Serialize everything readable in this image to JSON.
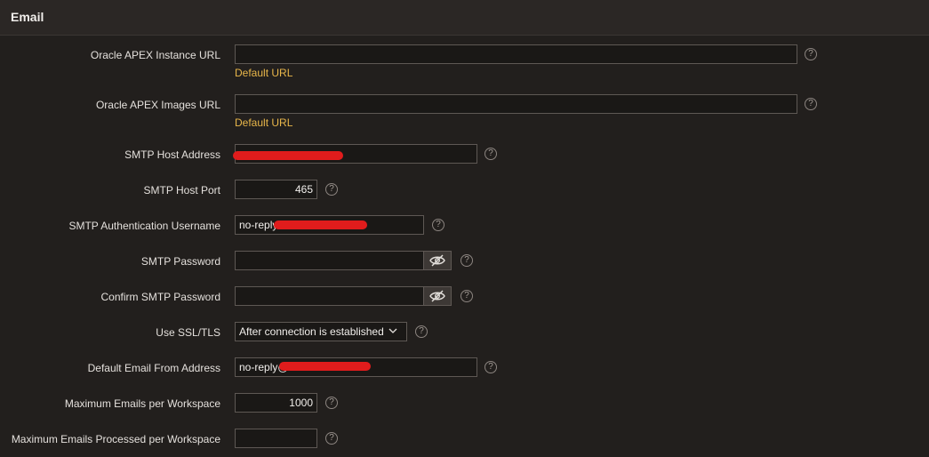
{
  "header": {
    "title": "Email"
  },
  "fields": {
    "instance_url": {
      "label": "Oracle APEX Instance URL",
      "value": "",
      "link": "Default URL"
    },
    "images_url": {
      "label": "Oracle APEX Images URL",
      "value": "",
      "link": "Default URL"
    },
    "smtp_host": {
      "label": "SMTP Host Address",
      "value": ""
    },
    "smtp_port": {
      "label": "SMTP Host Port",
      "value": "465"
    },
    "smtp_user": {
      "label": "SMTP Authentication Username",
      "value": "no-reply"
    },
    "smtp_password": {
      "label": "SMTP Password",
      "value": ""
    },
    "confirm_password": {
      "label": "Confirm SMTP Password",
      "value": ""
    },
    "ssl": {
      "label": "Use SSL/TLS",
      "value": "After connection is established"
    },
    "from_address": {
      "label": "Default Email From Address",
      "value": "no-reply@"
    },
    "max_emails": {
      "label": "Maximum Emails per Workspace",
      "value": "1000"
    },
    "max_processed": {
      "label": "Maximum Emails Processed per Workspace",
      "value": ""
    }
  },
  "help_glyph": "?",
  "icons": {
    "help": "help-circle-icon",
    "eye": "eye-slash-icon",
    "chevron": "chevron-down-icon"
  },
  "colors": {
    "accent_link": "#e8b64a",
    "redaction": "#e01c1c"
  }
}
